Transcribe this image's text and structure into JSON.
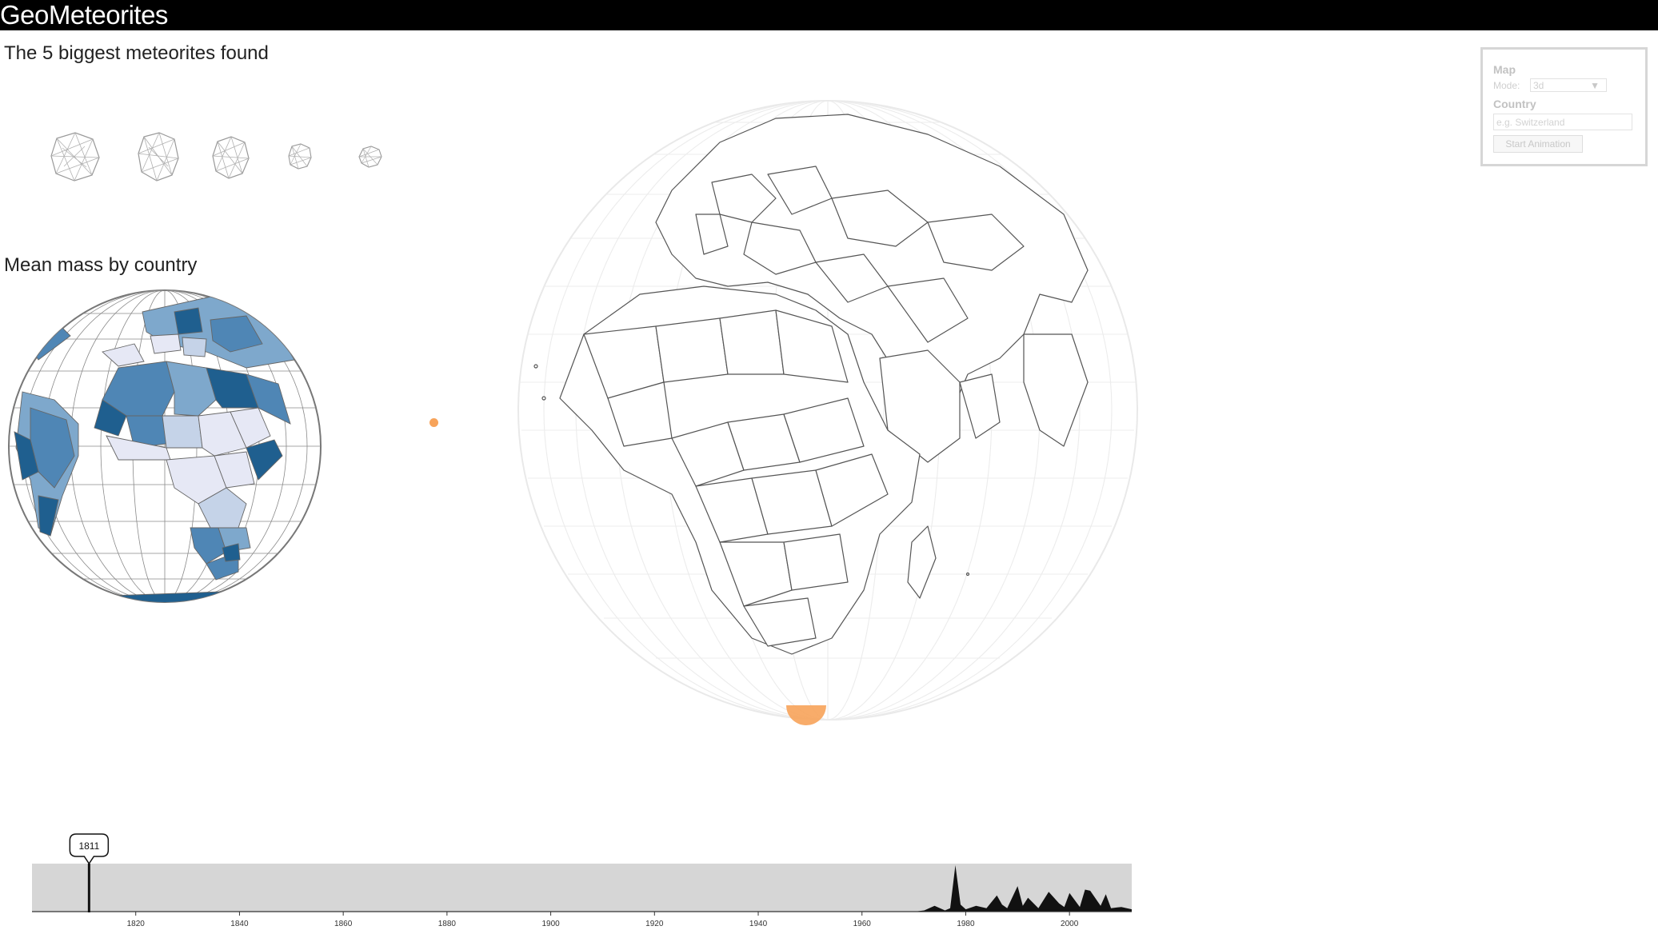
{
  "app": {
    "title": "GeoMeteorites"
  },
  "sections": {
    "biggest_title": "The 5 biggest meteorites found",
    "mean_mass_title": "Mean mass by country"
  },
  "control_panel": {
    "map_label": "Map",
    "mode_label": "Mode:",
    "mode_value": "3d",
    "country_label": "Country",
    "country_placeholder": "e.g. Switzerland",
    "start_animation_label": "Start Animation"
  },
  "timeline": {
    "current_year": "1811",
    "year_range": [
      1800,
      2012
    ],
    "ticks": [
      "1820",
      "1840",
      "1860",
      "1880",
      "1900",
      "1920",
      "1940",
      "1960",
      "1980",
      "2000"
    ]
  },
  "chart_data": {
    "type": "area",
    "x": [
      1800,
      1970,
      1972,
      1974,
      1976,
      1977,
      1978,
      1979,
      1980,
      1982,
      1984,
      1986,
      1987,
      1988,
      1990,
      1991,
      1992,
      1994,
      1996,
      1998,
      1999,
      2000,
      2002,
      2003,
      2004,
      2006,
      2007,
      2008,
      2010,
      2012
    ],
    "values": [
      0,
      0,
      1,
      5,
      1,
      3,
      40,
      6,
      2,
      5,
      3,
      14,
      6,
      3,
      22,
      5,
      12,
      3,
      17,
      7,
      4,
      16,
      4,
      19,
      18,
      5,
      15,
      3,
      4,
      2
    ],
    "xlim": [
      1800,
      2012
    ],
    "xlabel": "",
    "ylabel": ""
  },
  "colors": {
    "topbar": "#000000",
    "choropleth_dark": "#1f5f8f",
    "choropleth_mid": "#7ea8cc",
    "choropleth_light": "#e6e8f5",
    "impact": "#f7a35a",
    "timeline_bg": "#d6d6d6",
    "timeline_fill": "#111111"
  },
  "icons": {
    "dropdown": "triangle-down-icon"
  }
}
